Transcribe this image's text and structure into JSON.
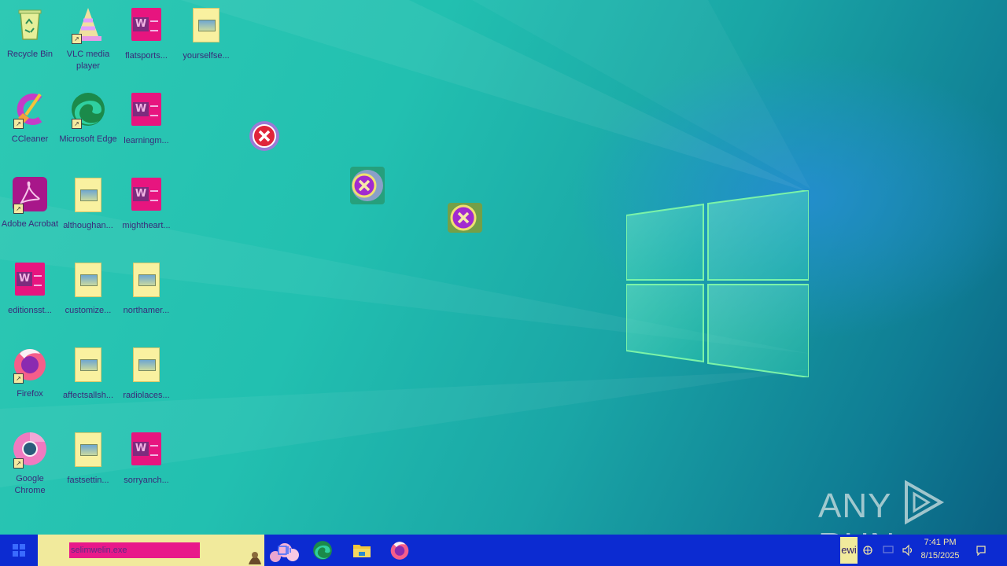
{
  "desktop": {
    "icons": [
      {
        "label": "Recycle Bin"
      },
      {
        "label": "VLC media player"
      },
      {
        "label": "flatsports..."
      },
      {
        "label": "yourselfse..."
      },
      {
        "label": "CCleaner"
      },
      {
        "label": "Microsoft Edge"
      },
      {
        "label": "learningm..."
      },
      {
        "label": "Adobe Acrobat"
      },
      {
        "label": "althoughan..."
      },
      {
        "label": "mightheart..."
      },
      {
        "label": "editionsst..."
      },
      {
        "label": "customize..."
      },
      {
        "label": "northamer..."
      },
      {
        "label": "Firefox"
      },
      {
        "label": "affectsallsh..."
      },
      {
        "label": "radiolaces..."
      },
      {
        "label": "Google Chrome"
      },
      {
        "label": "fastsettin..."
      },
      {
        "label": "sorryanch..."
      }
    ]
  },
  "taskbar": {
    "search_value": "selimwelin.exe",
    "ime_label": "ewi",
    "clock_time": "7:41 PM",
    "clock_date": "8/15/2025"
  },
  "watermark": {
    "left": "ANY",
    "right": "RUN"
  },
  "colors": {
    "taskbar": "#0c2bd1",
    "search_box": "#f1ea9c",
    "search_highlight": "#e8198a"
  }
}
